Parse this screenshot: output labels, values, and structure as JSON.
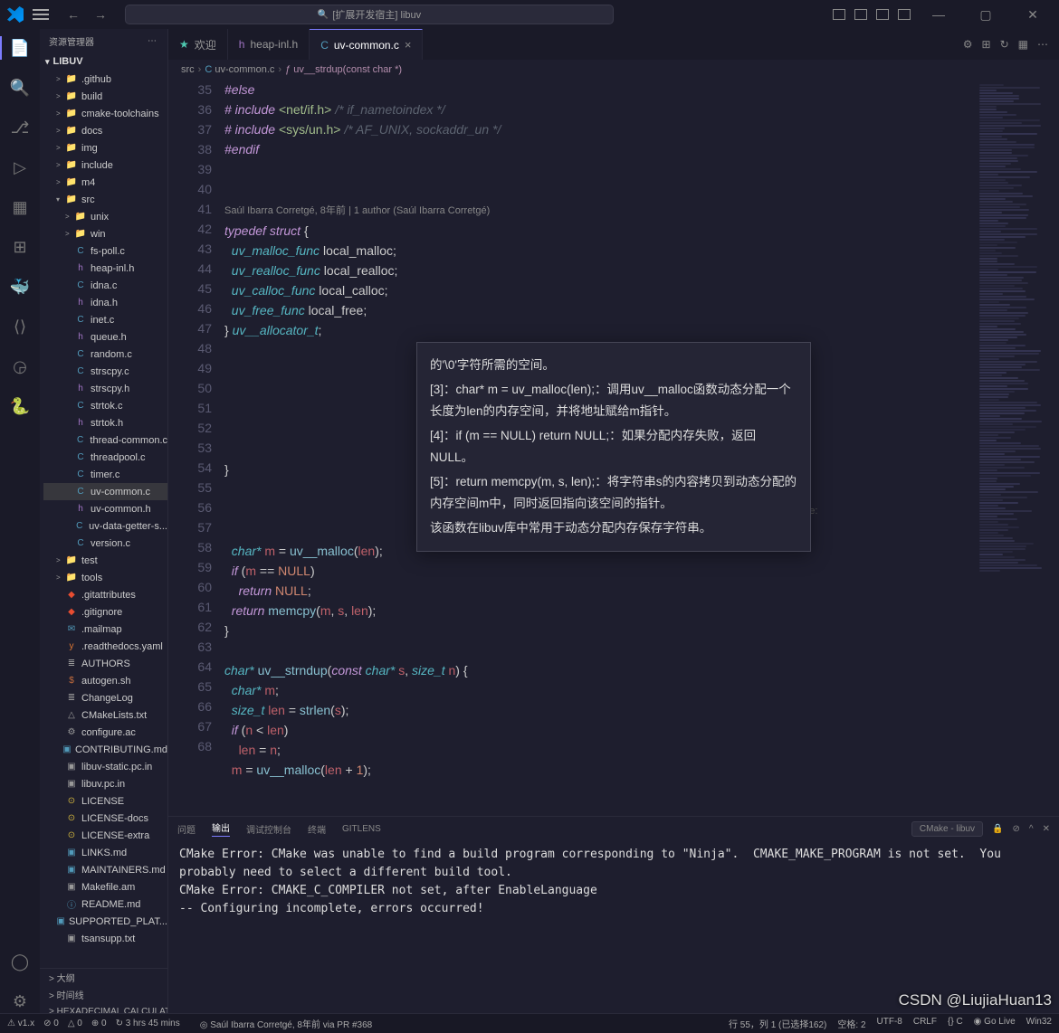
{
  "title": "[扩展开发宿主] libuv",
  "sidebar": {
    "header": "资源管理器",
    "root": "LIBUV",
    "items": [
      {
        "d": 0,
        "t": "folder",
        "chev": ">",
        "c": "folder",
        "ic": "📁",
        "label": ".github"
      },
      {
        "d": 0,
        "t": "folder",
        "chev": ">",
        "c": "folder",
        "ic": "📁",
        "label": "build"
      },
      {
        "d": 0,
        "t": "folder",
        "chev": ">",
        "c": "folder",
        "ic": "📁",
        "label": "cmake-toolchains"
      },
      {
        "d": 0,
        "t": "folder",
        "chev": ">",
        "c": "folder",
        "ic": "📁",
        "label": "docs"
      },
      {
        "d": 0,
        "t": "folder",
        "chev": ">",
        "c": "folder",
        "ic": "📁",
        "label": "img"
      },
      {
        "d": 0,
        "t": "folder",
        "chev": ">",
        "c": "folder",
        "ic": "📁",
        "label": "include"
      },
      {
        "d": 0,
        "t": "folder",
        "chev": ">",
        "c": "folder",
        "ic": "📁",
        "label": "m4"
      },
      {
        "d": 0,
        "t": "folder",
        "chev": "▾",
        "c": "folder",
        "ic": "📁",
        "label": "src"
      },
      {
        "d": 1,
        "t": "folder",
        "chev": ">",
        "c": "folder",
        "ic": "📁",
        "label": "unix"
      },
      {
        "d": 1,
        "t": "folder",
        "chev": ">",
        "c": "folder",
        "ic": "📁",
        "label": "win"
      },
      {
        "d": 1,
        "t": "file",
        "c": "cf",
        "ic": "C",
        "label": "fs-poll.c"
      },
      {
        "d": 1,
        "t": "file",
        "c": "hf",
        "ic": "h",
        "label": "heap-inl.h"
      },
      {
        "d": 1,
        "t": "file",
        "c": "cf",
        "ic": "C",
        "label": "idna.c"
      },
      {
        "d": 1,
        "t": "file",
        "c": "hf",
        "ic": "h",
        "label": "idna.h"
      },
      {
        "d": 1,
        "t": "file",
        "c": "cf",
        "ic": "C",
        "label": "inet.c"
      },
      {
        "d": 1,
        "t": "file",
        "c": "hf",
        "ic": "h",
        "label": "queue.h"
      },
      {
        "d": 1,
        "t": "file",
        "c": "cf",
        "ic": "C",
        "label": "random.c"
      },
      {
        "d": 1,
        "t": "file",
        "c": "cf",
        "ic": "C",
        "label": "strscpy.c"
      },
      {
        "d": 1,
        "t": "file",
        "c": "hf",
        "ic": "h",
        "label": "strscpy.h"
      },
      {
        "d": 1,
        "t": "file",
        "c": "cf",
        "ic": "C",
        "label": "strtok.c"
      },
      {
        "d": 1,
        "t": "file",
        "c": "hf",
        "ic": "h",
        "label": "strtok.h"
      },
      {
        "d": 1,
        "t": "file",
        "c": "cf",
        "ic": "C",
        "label": "thread-common.c"
      },
      {
        "d": 1,
        "t": "file",
        "c": "cf",
        "ic": "C",
        "label": "threadpool.c"
      },
      {
        "d": 1,
        "t": "file",
        "c": "cf",
        "ic": "C",
        "label": "timer.c"
      },
      {
        "d": 1,
        "t": "file",
        "c": "cf",
        "ic": "C",
        "label": "uv-common.c",
        "sel": true
      },
      {
        "d": 1,
        "t": "file",
        "c": "hf",
        "ic": "h",
        "label": "uv-common.h"
      },
      {
        "d": 1,
        "t": "file",
        "c": "cf",
        "ic": "C",
        "label": "uv-data-getter-s..."
      },
      {
        "d": 1,
        "t": "file",
        "c": "cf",
        "ic": "C",
        "label": "version.c"
      },
      {
        "d": 0,
        "t": "folder",
        "chev": ">",
        "c": "folder",
        "ic": "📁",
        "label": "test"
      },
      {
        "d": 0,
        "t": "folder",
        "chev": ">",
        "c": "folder",
        "ic": "📁",
        "label": "tools"
      },
      {
        "d": 0,
        "t": "file",
        "c": "git",
        "ic": "◆",
        ".label": ".gitattributes",
        "label": ".gitattributes"
      },
      {
        "d": 0,
        "t": "file",
        "c": "git",
        "ic": "◆",
        "label": ".gitignore"
      },
      {
        "d": 0,
        "t": "file",
        "c": "md",
        "ic": "✉",
        "label": ".mailmap"
      },
      {
        "d": 0,
        "t": "file",
        "c": "yml",
        "ic": "y",
        "label": ".readthedocs.yaml"
      },
      {
        "d": 0,
        "t": "file",
        "c": "txt",
        "ic": "≣",
        "label": "AUTHORS"
      },
      {
        "d": 0,
        "t": "file",
        "c": "sh",
        "ic": "$",
        "label": "autogen.sh"
      },
      {
        "d": 0,
        "t": "file",
        "c": "txt",
        "ic": "≣",
        "label": "ChangeLog"
      },
      {
        "d": 0,
        "t": "file",
        "c": "txt",
        "ic": "△",
        "label": "CMakeLists.txt"
      },
      {
        "d": 0,
        "t": "file",
        "c": "txt",
        "ic": "⚙",
        "label": "configure.ac"
      },
      {
        "d": 0,
        "t": "file",
        "c": "md",
        "ic": "▣",
        "label": "CONTRIBUTING.md"
      },
      {
        "d": 0,
        "t": "file",
        "c": "txt",
        "ic": "▣",
        "label": "libuv-static.pc.in"
      },
      {
        "d": 0,
        "t": "file",
        "c": "txt",
        "ic": "▣",
        "label": "libuv.pc.in"
      },
      {
        "d": 0,
        "t": "file",
        "c": "lic",
        "ic": "⊙",
        "label": "LICENSE"
      },
      {
        "d": 0,
        "t": "file",
        "c": "lic",
        "ic": "⊙",
        "label": "LICENSE-docs"
      },
      {
        "d": 0,
        "t": "file",
        "c": "lic",
        "ic": "⊙",
        "label": "LICENSE-extra"
      },
      {
        "d": 0,
        "t": "file",
        "c": "md",
        "ic": "▣",
        "label": "LINKS.md"
      },
      {
        "d": 0,
        "t": "file",
        "c": "md",
        "ic": "▣",
        "label": "MAINTAINERS.md"
      },
      {
        "d": 0,
        "t": "file",
        "c": "txt",
        "ic": "▣",
        "label": "Makefile.am"
      },
      {
        "d": 0,
        "t": "file",
        "c": "md",
        "ic": "ⓘ",
        "label": "README.md"
      },
      {
        "d": 0,
        "t": "file",
        "c": "md",
        "ic": "▣",
        "label": "SUPPORTED_PLAT..."
      },
      {
        "d": 0,
        "t": "file",
        "c": "txt",
        "ic": "▣",
        "label": "tsansupp.txt"
      }
    ],
    "footer": [
      "大纲",
      "时间线",
      "HEXADECIMAL CALCULATOR"
    ]
  },
  "tabs": [
    {
      "icon": "★",
      "label": "欢迎",
      "c": "#4ec9b0"
    },
    {
      "icon": "h",
      "label": "heap-inl.h",
      "c": "#a074c4"
    },
    {
      "icon": "C",
      "label": "uv-common.c",
      "c": "#519aba",
      "active": true,
      "close": true
    }
  ],
  "breadcrumb": [
    {
      "label": "src"
    },
    {
      "label": "uv-common.c",
      "c": "#519aba",
      "ic": "C"
    },
    {
      "label": "uv__strdup(const char *)",
      "fn": true,
      "ic": "ƒ"
    }
  ],
  "code": {
    "lens": "Saúl Ibarra Corretgé, 8年前 | 1 author (Saúl Ibarra Corretgé)",
    "blame": " Corretgé, 8年前 via PR #368 • core:",
    "startLine": 35,
    "lines": [
      {
        "n": 35,
        "h": "<span class=pp>#else</span>"
      },
      {
        "n": 36,
        "h": "<span class=pp># include</span> <span class=str>&lt;net/if.h&gt;</span> <span class=cm>/* if_nametoindex */</span>"
      },
      {
        "n": 37,
        "h": "<span class=pp># include</span> <span class=str>&lt;sys/un.h&gt;</span> <span class=cm>/* AF_UNIX, sockaddr_un */</span>"
      },
      {
        "n": 38,
        "h": "<span class=pp>#endif</span>"
      },
      {
        "n": 39,
        "h": ""
      },
      {
        "n": 40,
        "h": ""
      },
      {
        "n": -1,
        "h": "<span class=lens>Saúl Ibarra Corretgé, 8年前 | 1 author (Saúl Ibarra Corretgé)</span>"
      },
      {
        "n": 41,
        "h": "<span class=kw>typedef</span> <span class=kw>struct</span> {"
      },
      {
        "n": 42,
        "h": "  <span class=ty>uv_malloc_func</span> local_malloc;"
      },
      {
        "n": 43,
        "h": "  <span class=ty>uv_realloc_func</span> local_realloc;"
      },
      {
        "n": 44,
        "h": "  <span class=ty>uv_calloc_func</span> local_calloc;"
      },
      {
        "n": 45,
        "h": "  <span class=ty>uv_free_func</span> local_free;"
      },
      {
        "n": 46,
        "h": "} <span class=ty>uv__allocator_t</span>;"
      },
      {
        "n": 47,
        "h": ""
      },
      {
        "n": 48,
        "h": "&nbsp;"
      },
      {
        "n": 49,
        "h": "&nbsp;"
      },
      {
        "n": 50,
        "h": "&nbsp;"
      },
      {
        "n": 51,
        "h": "&nbsp;"
      },
      {
        "n": 52,
        "h": "&nbsp;"
      },
      {
        "n": 53,
        "h": "}"
      },
      {
        "n": 54,
        "h": ""
      },
      {
        "n": 55,
        "h": "<span class=blame> Corretgé, 8年前 via PR #368 • core:</span>",
        "indent": 470
      },
      {
        "n": 56,
        "h": "&nbsp;"
      },
      {
        "n": 57,
        "h": "  <span class=ty>char*</span> <span class=id>m</span> = <span class=fnc>uv__malloc</span>(<span class=id>len</span>);"
      },
      {
        "n": 58,
        "h": "  <span class=kw>if</span> (<span class=id>m</span> == <span class=num>NULL</span>)"
      },
      {
        "n": 59,
        "h": "    <span class=kw>return</span> <span class=num>NULL</span>;"
      },
      {
        "n": 60,
        "h": "  <span class=kw>return</span> <span class=fnc>memcpy</span>(<span class=id>m</span>, <span class=id>s</span>, <span class=id>len</span>);"
      },
      {
        "n": 61,
        "h": "}"
      },
      {
        "n": 62,
        "h": ""
      },
      {
        "n": 63,
        "h": "<span class=ty>char*</span> <span class=fnc>uv__strndup</span>(<span class=kw>const</span> <span class=ty>char*</span> <span class=id>s</span>, <span class=ty>size_t</span> <span class=id>n</span>) {"
      },
      {
        "n": 64,
        "h": "  <span class=ty>char*</span> <span class=id>m</span>;"
      },
      {
        "n": 65,
        "h": "  <span class=ty>size_t</span> <span class=id>len</span> = <span class=fnc>strlen</span>(<span class=id>s</span>);"
      },
      {
        "n": 66,
        "h": "  <span class=kw>if</span> (<span class=id>n</span> &lt; <span class=id>len</span>)"
      },
      {
        "n": 67,
        "h": "    <span class=id>len</span> = <span class=id>n</span>;"
      },
      {
        "n": 68,
        "h": "  <span class=id>m</span> = <span class=fnc>uv__malloc</span>(<span class=id>len</span> + <span class=num>1</span>);"
      }
    ]
  },
  "hover": [
    "的'\\0'字符所需的空间。",
    "[3]：char* m = uv_malloc(len);：调用uv__malloc函数动态分配一个长度为len的内存空间，并将地址赋给m指针。",
    "[4]：if (m == NULL) return NULL;：如果分配内存失败，返回NULL。",
    "[5]：return memcpy(m, s, len);：将字符串s的内容拷贝到动态分配的内存空间m中，同时返回指向该空间的指针。",
    "该函数在libuv库中常用于动态分配内存保存字符串。"
  ],
  "panel": {
    "tabs": [
      "问题",
      "输出",
      "调试控制台",
      "终端",
      "GITLENS"
    ],
    "active": 1,
    "task": "CMake - libuv",
    "output": "CMake Error: CMake was unable to find a build program corresponding to \"Ninja\".  CMAKE_MAKE_PROGRAM is not set.  You probably need to select a different build tool.\nCMake Error: CMAKE_C_COMPILER not set, after EnableLanguage\n-- Configuring incomplete, errors occurred!"
  },
  "statusbar": {
    "left": [
      "⚠ v1.x",
      "⊘ 0",
      "△ 0",
      "⊕ 0",
      "↻ 3 hrs 45 mins"
    ],
    "center": "◎ Saúl Ibarra Corretgé, 8年前 via PR #368",
    "right": [
      "行 55，列 1 (已选择162)",
      "空格: 2",
      "UTF-8",
      "CRLF",
      "{} C",
      "◉ Go Live",
      "Win32"
    ]
  },
  "watermark": "CSDN @LiujiaHuan13"
}
